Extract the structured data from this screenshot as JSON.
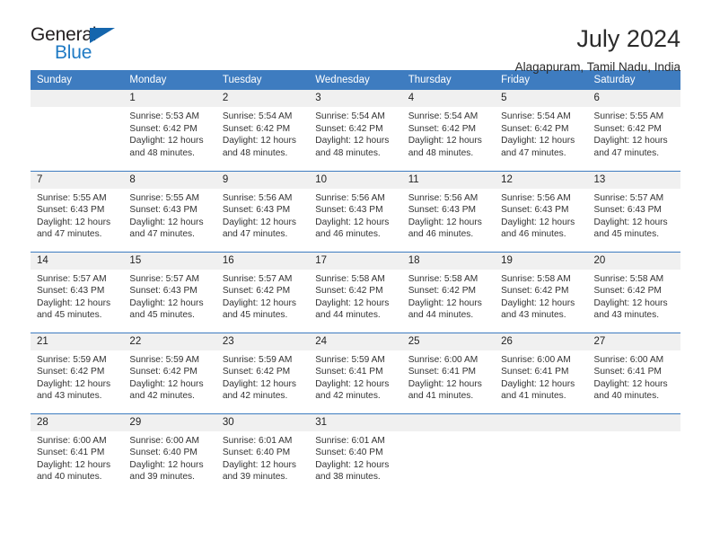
{
  "brand": {
    "name_part1": "General",
    "name_part2": "Blue",
    "accent_color": "#1f7ac4",
    "triangle_color": "#1566ad"
  },
  "header": {
    "title": "July 2024",
    "subtitle": "Alagapuram, Tamil Nadu, India"
  },
  "calendar": {
    "header_bg": "#3e7cc0",
    "daynum_bg": "#f0f0f0",
    "weekday_headers": [
      "Sunday",
      "Monday",
      "Tuesday",
      "Wednesday",
      "Thursday",
      "Friday",
      "Saturday"
    ],
    "weeks": [
      [
        {
          "day": "",
          "sunrise": "",
          "sunset": "",
          "daylight_line1": "",
          "daylight_line2": "",
          "empty": true
        },
        {
          "day": "1",
          "sunrise": "Sunrise: 5:53 AM",
          "sunset": "Sunset: 6:42 PM",
          "daylight_line1": "Daylight: 12 hours",
          "daylight_line2": "and 48 minutes."
        },
        {
          "day": "2",
          "sunrise": "Sunrise: 5:54 AM",
          "sunset": "Sunset: 6:42 PM",
          "daylight_line1": "Daylight: 12 hours",
          "daylight_line2": "and 48 minutes."
        },
        {
          "day": "3",
          "sunrise": "Sunrise: 5:54 AM",
          "sunset": "Sunset: 6:42 PM",
          "daylight_line1": "Daylight: 12 hours",
          "daylight_line2": "and 48 minutes."
        },
        {
          "day": "4",
          "sunrise": "Sunrise: 5:54 AM",
          "sunset": "Sunset: 6:42 PM",
          "daylight_line1": "Daylight: 12 hours",
          "daylight_line2": "and 48 minutes."
        },
        {
          "day": "5",
          "sunrise": "Sunrise: 5:54 AM",
          "sunset": "Sunset: 6:42 PM",
          "daylight_line1": "Daylight: 12 hours",
          "daylight_line2": "and 47 minutes."
        },
        {
          "day": "6",
          "sunrise": "Sunrise: 5:55 AM",
          "sunset": "Sunset: 6:42 PM",
          "daylight_line1": "Daylight: 12 hours",
          "daylight_line2": "and 47 minutes."
        }
      ],
      [
        {
          "day": "7",
          "sunrise": "Sunrise: 5:55 AM",
          "sunset": "Sunset: 6:43 PM",
          "daylight_line1": "Daylight: 12 hours",
          "daylight_line2": "and 47 minutes."
        },
        {
          "day": "8",
          "sunrise": "Sunrise: 5:55 AM",
          "sunset": "Sunset: 6:43 PM",
          "daylight_line1": "Daylight: 12 hours",
          "daylight_line2": "and 47 minutes."
        },
        {
          "day": "9",
          "sunrise": "Sunrise: 5:56 AM",
          "sunset": "Sunset: 6:43 PM",
          "daylight_line1": "Daylight: 12 hours",
          "daylight_line2": "and 47 minutes."
        },
        {
          "day": "10",
          "sunrise": "Sunrise: 5:56 AM",
          "sunset": "Sunset: 6:43 PM",
          "daylight_line1": "Daylight: 12 hours",
          "daylight_line2": "and 46 minutes."
        },
        {
          "day": "11",
          "sunrise": "Sunrise: 5:56 AM",
          "sunset": "Sunset: 6:43 PM",
          "daylight_line1": "Daylight: 12 hours",
          "daylight_line2": "and 46 minutes."
        },
        {
          "day": "12",
          "sunrise": "Sunrise: 5:56 AM",
          "sunset": "Sunset: 6:43 PM",
          "daylight_line1": "Daylight: 12 hours",
          "daylight_line2": "and 46 minutes."
        },
        {
          "day": "13",
          "sunrise": "Sunrise: 5:57 AM",
          "sunset": "Sunset: 6:43 PM",
          "daylight_line1": "Daylight: 12 hours",
          "daylight_line2": "and 45 minutes."
        }
      ],
      [
        {
          "day": "14",
          "sunrise": "Sunrise: 5:57 AM",
          "sunset": "Sunset: 6:43 PM",
          "daylight_line1": "Daylight: 12 hours",
          "daylight_line2": "and 45 minutes."
        },
        {
          "day": "15",
          "sunrise": "Sunrise: 5:57 AM",
          "sunset": "Sunset: 6:43 PM",
          "daylight_line1": "Daylight: 12 hours",
          "daylight_line2": "and 45 minutes."
        },
        {
          "day": "16",
          "sunrise": "Sunrise: 5:57 AM",
          "sunset": "Sunset: 6:42 PM",
          "daylight_line1": "Daylight: 12 hours",
          "daylight_line2": "and 45 minutes."
        },
        {
          "day": "17",
          "sunrise": "Sunrise: 5:58 AM",
          "sunset": "Sunset: 6:42 PM",
          "daylight_line1": "Daylight: 12 hours",
          "daylight_line2": "and 44 minutes."
        },
        {
          "day": "18",
          "sunrise": "Sunrise: 5:58 AM",
          "sunset": "Sunset: 6:42 PM",
          "daylight_line1": "Daylight: 12 hours",
          "daylight_line2": "and 44 minutes."
        },
        {
          "day": "19",
          "sunrise": "Sunrise: 5:58 AM",
          "sunset": "Sunset: 6:42 PM",
          "daylight_line1": "Daylight: 12 hours",
          "daylight_line2": "and 43 minutes."
        },
        {
          "day": "20",
          "sunrise": "Sunrise: 5:58 AM",
          "sunset": "Sunset: 6:42 PM",
          "daylight_line1": "Daylight: 12 hours",
          "daylight_line2": "and 43 minutes."
        }
      ],
      [
        {
          "day": "21",
          "sunrise": "Sunrise: 5:59 AM",
          "sunset": "Sunset: 6:42 PM",
          "daylight_line1": "Daylight: 12 hours",
          "daylight_line2": "and 43 minutes."
        },
        {
          "day": "22",
          "sunrise": "Sunrise: 5:59 AM",
          "sunset": "Sunset: 6:42 PM",
          "daylight_line1": "Daylight: 12 hours",
          "daylight_line2": "and 42 minutes."
        },
        {
          "day": "23",
          "sunrise": "Sunrise: 5:59 AM",
          "sunset": "Sunset: 6:42 PM",
          "daylight_line1": "Daylight: 12 hours",
          "daylight_line2": "and 42 minutes."
        },
        {
          "day": "24",
          "sunrise": "Sunrise: 5:59 AM",
          "sunset": "Sunset: 6:41 PM",
          "daylight_line1": "Daylight: 12 hours",
          "daylight_line2": "and 42 minutes."
        },
        {
          "day": "25",
          "sunrise": "Sunrise: 6:00 AM",
          "sunset": "Sunset: 6:41 PM",
          "daylight_line1": "Daylight: 12 hours",
          "daylight_line2": "and 41 minutes."
        },
        {
          "day": "26",
          "sunrise": "Sunrise: 6:00 AM",
          "sunset": "Sunset: 6:41 PM",
          "daylight_line1": "Daylight: 12 hours",
          "daylight_line2": "and 41 minutes."
        },
        {
          "day": "27",
          "sunrise": "Sunrise: 6:00 AM",
          "sunset": "Sunset: 6:41 PM",
          "daylight_line1": "Daylight: 12 hours",
          "daylight_line2": "and 40 minutes."
        }
      ],
      [
        {
          "day": "28",
          "sunrise": "Sunrise: 6:00 AM",
          "sunset": "Sunset: 6:41 PM",
          "daylight_line1": "Daylight: 12 hours",
          "daylight_line2": "and 40 minutes."
        },
        {
          "day": "29",
          "sunrise": "Sunrise: 6:00 AM",
          "sunset": "Sunset: 6:40 PM",
          "daylight_line1": "Daylight: 12 hours",
          "daylight_line2": "and 39 minutes."
        },
        {
          "day": "30",
          "sunrise": "Sunrise: 6:01 AM",
          "sunset": "Sunset: 6:40 PM",
          "daylight_line1": "Daylight: 12 hours",
          "daylight_line2": "and 39 minutes."
        },
        {
          "day": "31",
          "sunrise": "Sunrise: 6:01 AM",
          "sunset": "Sunset: 6:40 PM",
          "daylight_line1": "Daylight: 12 hours",
          "daylight_line2": "and 38 minutes."
        },
        {
          "day": "",
          "sunrise": "",
          "sunset": "",
          "daylight_line1": "",
          "daylight_line2": "",
          "empty": true
        },
        {
          "day": "",
          "sunrise": "",
          "sunset": "",
          "daylight_line1": "",
          "daylight_line2": "",
          "empty": true
        },
        {
          "day": "",
          "sunrise": "",
          "sunset": "",
          "daylight_line1": "",
          "daylight_line2": "",
          "empty": true
        }
      ]
    ]
  }
}
